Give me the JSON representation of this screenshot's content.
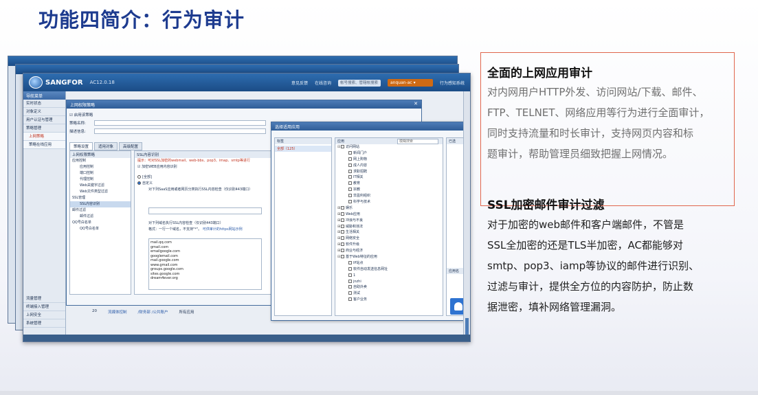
{
  "slide": {
    "title": "功能四简介：行为审计"
  },
  "app": {
    "brand": "SANGFOR",
    "version": "AC12.0.18",
    "top_nav": [
      "意见反馈",
      "在线咨询",
      "帐号搜索、管辖帐搜索",
      "anquan-ac ▾",
      "行为感知系统"
    ],
    "search_placeholder": "帐号搜索、管辖帐搜索",
    "user": "anquan-ac ▾",
    "nav_header": "导航菜单",
    "nav_items": [
      "实时状态",
      "对象定义",
      "用户认证与管理",
      "策略管理",
      "上网策略",
      "策略在线应用"
    ],
    "nav_bottom": [
      "流量管理",
      "终端接入管理",
      "上网安全",
      "系统管理"
    ],
    "policy_dialog": {
      "title": "上网权限策略",
      "enable_label": "启用该策略",
      "name_label": "策略名称:",
      "desc_label": "描述信息:",
      "tabs": [
        "策略设置",
        "适用对象",
        "高级配置"
      ],
      "tree_header": "上网权限策略",
      "tree": [
        {
          "label": "应用控制",
          "level": 1
        },
        {
          "label": "应用控制",
          "level": 2
        },
        {
          "label": "端口控制",
          "level": 2
        },
        {
          "label": "代理控制",
          "level": 2
        },
        {
          "label": "Web关键字过滤",
          "level": 2
        },
        {
          "label": "Web文件类型过滤",
          "level": 2
        },
        {
          "label": "SSL管理",
          "level": 1
        },
        {
          "label": "SSL内容识别",
          "level": 2
        },
        {
          "label": "邮件过滤",
          "level": 1
        },
        {
          "label": "邮件过滤",
          "level": 2
        },
        {
          "label": "QQ号白名单",
          "level": 1
        },
        {
          "label": "QQ号白名单",
          "level": 2
        }
      ],
      "content_header": "SSL内容识别",
      "hint": "提示：可对SSL加密的webmail、web-bbs、pop3、imap、smtp等进行",
      "decrypt_label": "加密WEB应用内容识别",
      "option_all": "[全部]",
      "option_custom": "自定义",
      "check_label": "对下列SaaS应用或者网页分类执行SSL内容检查（仅识别443端口）",
      "ref_label": "对下列域名执行SSL内容检查（仅识别443端口）",
      "format_label": "格式：一行一个域名，不支持\"*\"。",
      "link": "可供审计的https网站示例",
      "domains": [
        "mail.qq.com",
        "gmail.com",
        "emailgoogle.com",
        "googlemail.com",
        "mail.google.com",
        "www.gmail.com",
        "groups.google.com",
        "sites.google.com",
        "dream4ever.org"
      ]
    },
    "select_dialog": {
      "title": "选择适用应用",
      "tag_header": "标签",
      "tag_item": "全部（125）",
      "app_header": "应用",
      "search_placeholder": "模糊搜索",
      "right_header": "已选",
      "right_header2": "应用名",
      "apps": [
        {
          "label": "访问网站",
          "level": 1,
          "ex": "⊟"
        },
        {
          "label": "新闻门户",
          "level": 2,
          "ex": ""
        },
        {
          "label": "网上购物",
          "level": 2,
          "ex": ""
        },
        {
          "label": "成人内容",
          "level": 2,
          "ex": ""
        },
        {
          "label": "求职招聘",
          "level": 2,
          "ex": ""
        },
        {
          "label": "IT相关",
          "level": 2,
          "ex": ""
        },
        {
          "label": "教育",
          "level": 2,
          "ex": ""
        },
        {
          "label": "宗教",
          "level": 2,
          "ex": ""
        },
        {
          "label": "非盈利组织",
          "level": 2,
          "ex": ""
        },
        {
          "label": "科学与技术",
          "level": 2,
          "ex": ""
        },
        {
          "label": "娱乐",
          "level": 1,
          "ex": "⊞"
        },
        {
          "label": "Web应用",
          "level": 1,
          "ex": "⊞"
        },
        {
          "label": "冲浪与不良",
          "level": 1,
          "ex": "⊞"
        },
        {
          "label": "威胁和违法",
          "level": 1,
          "ex": "⊞"
        },
        {
          "label": "生活相关",
          "level": 1,
          "ex": "⊞"
        },
        {
          "label": "网络安全",
          "level": 1,
          "ex": "⊞"
        },
        {
          "label": "软件升级",
          "level": 1,
          "ex": "⊞"
        },
        {
          "label": "商业与经济",
          "level": 1,
          "ex": "⊞"
        },
        {
          "label": "基于Web特征的应用",
          "level": 1,
          "ex": "⊟"
        },
        {
          "label": "IP站点",
          "level": 2,
          "ex": ""
        },
        {
          "label": "软件自动发送信息网址",
          "level": 2,
          "ex": ""
        },
        {
          "label": "1",
          "level": 2,
          "ex": ""
        },
        {
          "label": "jnzhi",
          "level": 2,
          "ex": ""
        },
        {
          "label": "自助外卖",
          "level": 2,
          "ex": ""
        },
        {
          "label": "测试",
          "level": 2,
          "ex": ""
        },
        {
          "label": "客户业务",
          "level": 2,
          "ex": ""
        }
      ]
    },
    "status_row": [
      "20",
      "流媒体控制",
      "/财务部 /公共账户",
      "所有应用"
    ]
  },
  "callout": {
    "heading": "全面的上网应用审计",
    "lines": [
      "对内网用户HTTP外发、访问网站/下载、邮件、",
      "FTP、TELNET、网络应用等行为进行全面审计，",
      "同时支持流量和时长审计，支持网页内容和标",
      "题审计，帮助管理员细致把握上网情况。"
    ]
  },
  "section2": {
    "heading": "SSL加密邮件审计过滤",
    "lines": [
      "对于加密的web邮件和客户端邮件，不管是",
      "SSL全加密的还是TLS半加密，AC都能够对",
      "smtp、pop3、iamp等协议的邮件进行识别、",
      "过滤与审计，提供全方位的内容防护，防止数",
      "据泄密，填补网络管理漏洞。"
    ]
  },
  "colors": {
    "title_blue": "#1d3b8f",
    "callout_border": "#e0654c",
    "app_header_blue": "#1b4c86",
    "hint_red": "#c0321e"
  }
}
